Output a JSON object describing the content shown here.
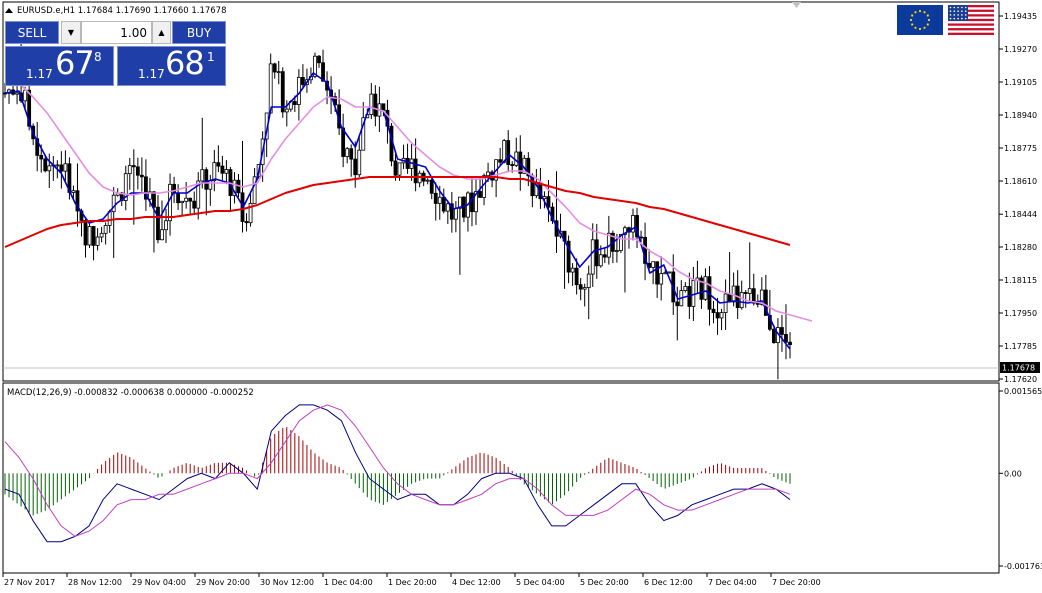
{
  "symbol_info": "EURUSD.e,H1  1.17684 1.17690 1.17660 1.17678",
  "trade": {
    "sell_label": "SELL",
    "buy_label": "BUY",
    "lot": "1.00",
    "sell_small": "1.17",
    "sell_big": "67",
    "sell_sup": "8",
    "buy_small": "1.17",
    "buy_big": "68",
    "buy_sup": "1"
  },
  "icons": {
    "collapse": "triangle-up-icon",
    "lot_down": "arrow-down-icon",
    "lot_up": "arrow-up-icon",
    "flag_base": "eu-flag-icon",
    "flag_quote": "us-flag-icon"
  },
  "colors": {
    "candle": "#000000",
    "ma_fast": "#0000cc",
    "ma_mid": "#e58ee5",
    "ma_slow": "#e00000",
    "macd_pos": "#a50000",
    "macd_neg": "#006400",
    "macd_main": "#000080",
    "macd_signal": "#c040c0",
    "panel": "#1f3ea8"
  },
  "macd_label": "MACD(12,26,9) -0.000832 -0.000638 0.000000 -0.000252",
  "chart_data": [
    {
      "type": "candlestick",
      "title": "EURUSD.e,H1  1.17684 1.17690 1.17660 1.17678",
      "y_ticks": [
        "1.19435",
        "1.19270",
        "1.19105",
        "1.18940",
        "1.18775",
        "1.18610",
        "1.18444",
        "1.18280",
        "1.18115",
        "1.17950",
        "1.17785",
        "1.17620"
      ],
      "y_range": [
        1.1762,
        1.19435
      ],
      "current_price": "1.17678",
      "x_ticks": [
        "27 Nov 2017",
        "28 Nov 12:00",
        "29 Nov 04:00",
        "29 Nov 20:00",
        "30 Nov 12:00",
        "1 Dec 04:00",
        "1 Dec 20:00",
        "4 Dec 12:00",
        "5 Dec 04:00",
        "5 Dec 20:00",
        "6 Dec 12:00",
        "7 Dec 04:00",
        "7 Dec 20:00"
      ],
      "price_path": [
        1.1905,
        1.191,
        1.1885,
        1.187,
        1.187,
        1.185,
        1.1832,
        1.1843,
        1.1852,
        1.187,
        1.186,
        1.1835,
        1.1858,
        1.1851,
        1.1859,
        1.1866,
        1.1862,
        1.1842,
        1.1865,
        1.1918,
        1.19,
        1.1908,
        1.1922,
        1.1907,
        1.188,
        1.1868,
        1.1905,
        1.1893,
        1.1862,
        1.1868,
        1.1866,
        1.1853,
        1.1843,
        1.1848,
        1.186,
        1.187,
        1.1876,
        1.1866,
        1.1855,
        1.184,
        1.1825,
        1.181,
        1.1825,
        1.1828,
        1.1833,
        1.184,
        1.181,
        1.1822,
        1.1797,
        1.1805,
        1.1807,
        1.1798,
        1.1802,
        1.18,
        1.1805,
        1.1783,
        1.1776
      ],
      "series": [
        {
          "name": "",
          "role": "ma_fast",
          "values": [
            1.1905,
            1.1906,
            1.1885,
            1.1872,
            1.1865,
            1.185,
            1.184,
            1.1842,
            1.185,
            1.1855,
            1.1855,
            1.1842,
            1.1855,
            1.1855,
            1.186,
            1.1862,
            1.186,
            1.1848,
            1.1862,
            1.1898,
            1.1898,
            1.1905,
            1.1915,
            1.191,
            1.1888,
            1.1878,
            1.1898,
            1.1896,
            1.1872,
            1.187,
            1.1868,
            1.1856,
            1.1847,
            1.1849,
            1.1858,
            1.1866,
            1.1874,
            1.1868,
            1.1858,
            1.1843,
            1.183,
            1.1818,
            1.1826,
            1.1828,
            1.1834,
            1.1838,
            1.1815,
            1.1819,
            1.1802,
            1.1804,
            1.1806,
            1.18,
            1.1801,
            1.18,
            1.1801,
            1.1786,
            1.1777
          ]
        },
        {
          "name": "",
          "role": "ma_mid",
          "values": [
            1.1912,
            1.191,
            1.1903,
            1.1895,
            1.1885,
            1.1875,
            1.1865,
            1.1858,
            1.1855,
            1.1854,
            1.1855,
            1.1855,
            1.1856,
            1.1858,
            1.186,
            1.186,
            1.186,
            1.1858,
            1.186,
            1.1872,
            1.1882,
            1.189,
            1.1898,
            1.1903,
            1.1902,
            1.1898,
            1.1898,
            1.1896,
            1.1888,
            1.188,
            1.1874,
            1.1868,
            1.1864,
            1.1862,
            1.1862,
            1.1864,
            1.1866,
            1.1866,
            1.1862,
            1.1855,
            1.1848,
            1.184,
            1.1836,
            1.1834,
            1.1832,
            1.1832,
            1.1826,
            1.1822,
            1.1816,
            1.1812,
            1.181,
            1.1806,
            1.1804,
            1.1801,
            1.18,
            1.1796,
            1.1791
          ]
        },
        {
          "name": "",
          "role": "ma_slow",
          "values": [
            1.1828,
            1.1831,
            1.1834,
            1.1837,
            1.1839,
            1.184,
            1.1841,
            1.1841,
            1.1842,
            1.1842,
            1.1843,
            1.1843,
            1.1843,
            1.1844,
            1.1845,
            1.1846,
            1.1846,
            1.1847,
            1.1849,
            1.1852,
            1.1855,
            1.1857,
            1.1859,
            1.186,
            1.1861,
            1.1862,
            1.1863,
            1.1863,
            1.1863,
            1.1863,
            1.1863,
            1.1863,
            1.1863,
            1.1863,
            1.1863,
            1.1863,
            1.1862,
            1.1862,
            1.186,
            1.1858,
            1.1856,
            1.1855,
            1.1853,
            1.1852,
            1.1851,
            1.185,
            1.1848,
            1.1847,
            1.1845,
            1.1843,
            1.1841,
            1.1839,
            1.1837,
            1.1835,
            1.1833,
            1.1831,
            1.1829
          ]
        }
      ]
    },
    {
      "type": "bar",
      "title": "MACD(12,26,9) -0.000832 -0.000638 0.000000 -0.000252",
      "y_ticks": [
        "0.001565",
        "0.00",
        "-0.001763"
      ],
      "y_range": [
        -0.001763,
        0.001565
      ],
      "histogram": [
        -0.0004,
        -0.0006,
        -0.0008,
        -0.0007,
        -0.0005,
        -0.0003,
        -0.0001,
        0.0002,
        0.0004,
        0.0003,
        0.0001,
        -0.0001,
        0.0001,
        0.0002,
        0.0001,
        0.0002,
        0.0002,
        0.0001,
        -0.0001,
        0.0007,
        0.0009,
        0.0007,
        0.0004,
        0.0002,
        0.0001,
        -0.0002,
        -0.0005,
        -0.0006,
        -0.0004,
        -0.0002,
        -0.0001,
        -0.0001,
        0.0001,
        0.0003,
        0.0004,
        0.0003,
        0.0001,
        -0.0002,
        -0.0004,
        -0.0006,
        -0.0004,
        -0.0001,
        0.0001,
        0.0003,
        0.0002,
        0.0001,
        -0.0001,
        -0.0003,
        -0.0002,
        -0.0001,
        0.0001,
        0.0002,
        0.0001,
        0.0001,
        0.0001,
        -0.0001,
        -0.0002
      ],
      "series": [
        {
          "name": "",
          "role": "macd_main",
          "values": [
            -0.0003,
            -0.0004,
            -0.0009,
            -0.0013,
            -0.0013,
            -0.0012,
            -0.001,
            -0.0005,
            -0.0002,
            -0.0003,
            -0.0004,
            -0.0005,
            -0.0003,
            -0.0001,
            0.0,
            -0.0001,
            0.0002,
            0.0,
            -0.0003,
            0.0008,
            0.0011,
            0.0013,
            0.0013,
            0.0012,
            0.001,
            0.0004,
            -0.0001,
            -0.0003,
            -0.0005,
            -0.0004,
            -0.0004,
            -0.0006,
            -0.0006,
            -0.0004,
            -0.0001,
            0.0,
            0.0,
            -0.0001,
            -0.0006,
            -0.001,
            -0.001,
            -0.0008,
            -0.0006,
            -0.0004,
            -0.0002,
            -0.0002,
            -0.0006,
            -0.0009,
            -0.0008,
            -0.0006,
            -0.0005,
            -0.0004,
            -0.0003,
            -0.0003,
            -0.0002,
            -0.0003,
            -0.0005
          ]
        },
        {
          "name": "",
          "role": "macd_signal",
          "values": [
            0.0006,
            0.0003,
            -0.0001,
            -0.0006,
            -0.001,
            -0.0012,
            -0.0011,
            -0.0009,
            -0.0006,
            -0.0005,
            -0.0005,
            -0.0004,
            -0.0004,
            -0.0003,
            -0.0002,
            -0.0001,
            0.0,
            0.0,
            -0.0001,
            0.0002,
            0.0006,
            0.001,
            0.0012,
            0.0013,
            0.0012,
            0.0009,
            0.0005,
            0.0001,
            -0.0002,
            -0.0004,
            -0.0005,
            -0.0006,
            -0.0006,
            -0.0005,
            -0.0004,
            -0.0002,
            -0.0001,
            -0.0001,
            -0.0003,
            -0.0006,
            -0.0008,
            -0.0008,
            -0.0008,
            -0.0007,
            -0.0005,
            -0.0003,
            -0.0004,
            -0.0006,
            -0.0007,
            -0.0007,
            -0.0006,
            -0.0005,
            -0.0004,
            -0.0003,
            -0.0003,
            -0.0003,
            -0.0004
          ]
        }
      ]
    }
  ]
}
